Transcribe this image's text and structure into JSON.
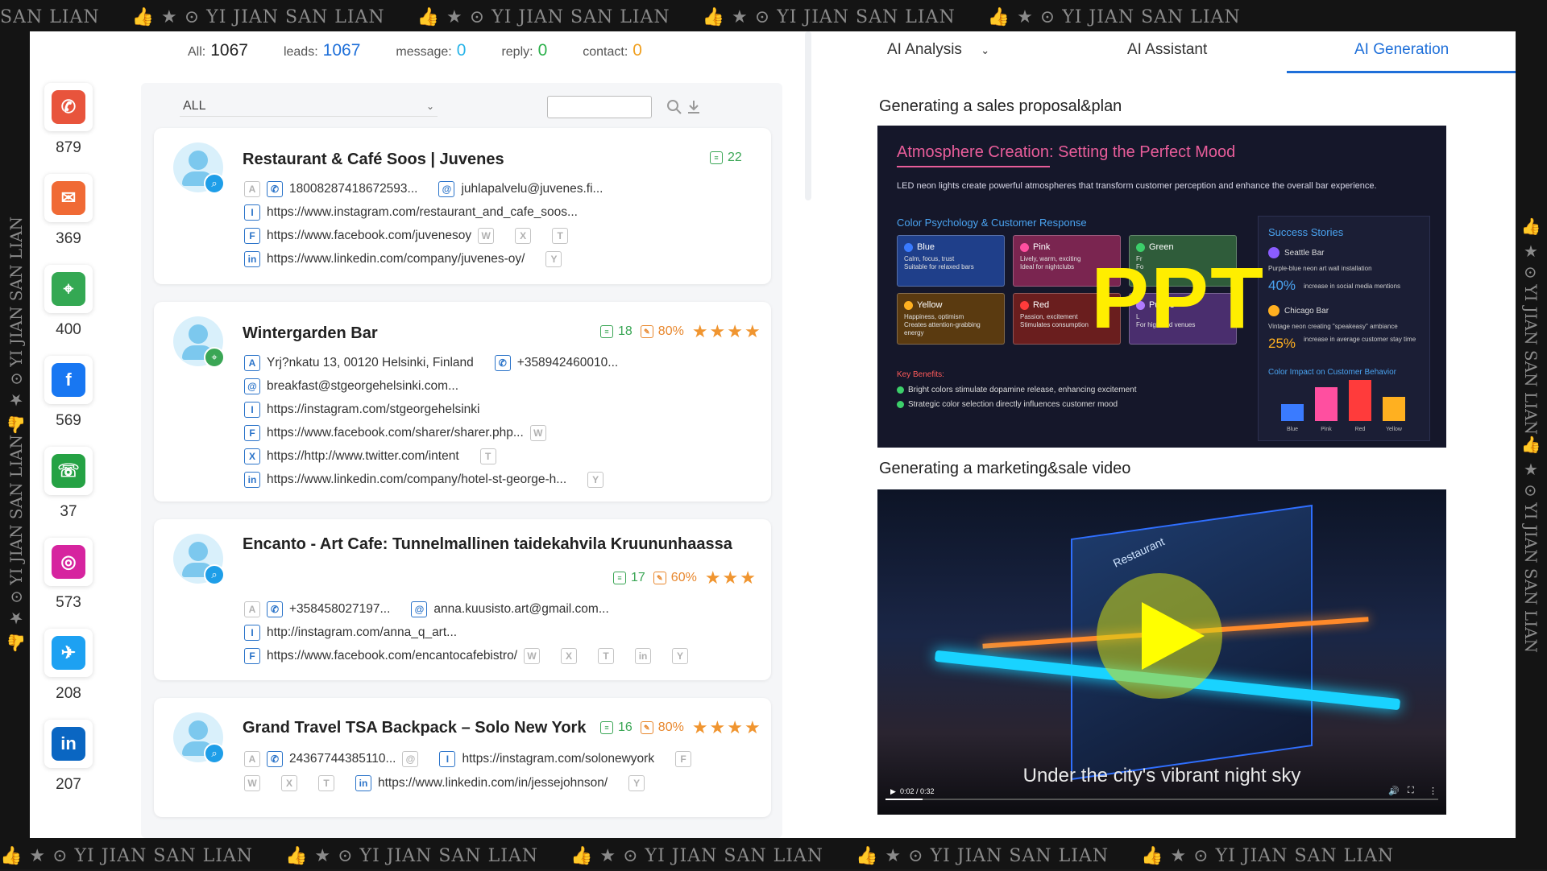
{
  "watermark": "👍 ★ ⊙ YI JIAN SAN LIAN",
  "watermark_head": "SAN LIAN",
  "social": [
    {
      "name": "phone",
      "count": "879",
      "color": "#e8543c",
      "glyph": "✆"
    },
    {
      "name": "email",
      "count": "369",
      "color": "#f06a35",
      "glyph": "✉"
    },
    {
      "name": "maps",
      "count": "400",
      "color": "#34a853",
      "glyph": "⌖"
    },
    {
      "name": "facebook",
      "count": "569",
      "color": "#1877f2",
      "glyph": "f"
    },
    {
      "name": "whatsapp",
      "count": "37",
      "color": "#25a244",
      "glyph": "☏"
    },
    {
      "name": "instagram",
      "count": "573",
      "color": "#d6249f",
      "glyph": "◎"
    },
    {
      "name": "twitter",
      "count": "208",
      "color": "#1da1f2",
      "glyph": "✈"
    },
    {
      "name": "linkedin",
      "count": "207",
      "color": "#0a66c2",
      "glyph": "in"
    }
  ],
  "stats": {
    "all_label": "All:",
    "all_value": "1067",
    "leads_label": "leads:",
    "leads_value": "1067",
    "message_label": "message:",
    "message_value": "0",
    "reply_label": "reply:",
    "reply_value": "0",
    "contact_label": "contact:",
    "contact_value": "0"
  },
  "filter": {
    "selected": "ALL"
  },
  "cards": [
    {
      "title": "Restaurant & Café Soos | Juvenes",
      "count": "22",
      "phone": "18008287418672593...",
      "email": "juhlapalvelu@juvenes.fi...",
      "instagram": "https://www.instagram.com/restaurant_and_cafe_soos...",
      "facebook": "https://www.facebook.com/juvenesoy",
      "linkedin": "https://www.linkedin.com/company/juvenes-oy/"
    },
    {
      "title": "Wintergarden Bar",
      "count": "18",
      "percent": "80%",
      "address": "Yrj?nkatu 13, 00120 Helsinki, Finland",
      "phone": "+358942460010...",
      "email": "breakfast@stgeorgehelsinki.com...",
      "instagram": "https://instagram.com/stgeorgehelsinki",
      "facebook": "https://www.facebook.com/sharer/sharer.php...",
      "twitter": "https://http://www.twitter.com/intent",
      "linkedin": "https://www.linkedin.com/company/hotel-st-george-h..."
    },
    {
      "title": "Encanto - Art Cafe: Tunnelmallinen taidekahvila Kruununhaassa",
      "count": "17",
      "percent": "60%",
      "phone": "+358458027197...",
      "email": "anna.kuusisto.art@gmail.com...",
      "instagram": "http://instagram.com/anna_q_art...",
      "facebook": "https://www.facebook.com/encantocafebistro/"
    },
    {
      "title": "Grand Travel TSA Backpack – Solo New York",
      "count": "16",
      "percent": "80%",
      "phone": "24367744385110...",
      "instagram": "https://instagram.com/solonewyork",
      "linkedin": "https://www.linkedin.com/in/jessejohnson/"
    }
  ],
  "tabs": {
    "analysis": "AI Analysis",
    "assistant": "AI Assistant",
    "generation": "AI Generation"
  },
  "section1": "Generating a sales proposal&plan",
  "section2": "Generating a marketing&sale video",
  "ppt": {
    "title": "Atmosphere Creation: Setting the Perfect Mood",
    "desc": "LED neon lights create powerful atmospheres that transform customer perception and enhance the overall bar experience.",
    "subtitle": "Color Psychology & Customer Response",
    "big": "PPT",
    "colors": [
      {
        "label": "Blue",
        "color": "#3a7bff",
        "d1": "Calm, focus, trust",
        "d2": "Suitable for relaxed bars",
        "bg": "#1f3f8a"
      },
      {
        "label": "Pink",
        "color": "#ff4fa0",
        "d1": "Lively, warm, exciting",
        "d2": "Ideal for nightclubs",
        "bg": "#7a2550"
      },
      {
        "label": "Green",
        "color": "#3ccf6a",
        "d1": "Fr",
        "d2": "Fo",
        "bg": "#2f5c3a"
      },
      {
        "label": "Yellow",
        "color": "#ffb020",
        "d1": "Happiness, optimism",
        "d2": "Creates attention-grabbing energy",
        "bg": "#5a3a10"
      },
      {
        "label": "Red",
        "color": "#ff3b3b",
        "d1": "Passion, excitement",
        "d2": "Stimulates consumption",
        "bg": "#6a1e1e"
      },
      {
        "label": "Purple",
        "color": "#b07aff",
        "d1": "L",
        "d2": "For high-end venues",
        "bg": "#4a2e6e"
      }
    ],
    "benefits_title": "Key Benefits:",
    "benefits": [
      "Bright colors stimulate dopamine release, enhancing excitement",
      "Strategic color selection directly influences customer mood"
    ],
    "success_title": "Success Stories",
    "story1_name": "Seattle Bar",
    "story1_text": "Purple-blue neon art wall installation",
    "story1_num": "40%",
    "story1_desc": "increase in social media mentions",
    "story2_name": "Chicago Bar",
    "story2_text": "Vintage neon creating \"speakeasy\" ambiance",
    "story2_num": "25%",
    "story2_desc": "increase in average customer stay time",
    "impact_title": "Color Impact on Customer Behavior",
    "bars": [
      {
        "label": "Blue",
        "value": 0.35,
        "color": "#3a7bff"
      },
      {
        "label": "Pink",
        "value": 0.7,
        "color": "#ff4fa0"
      },
      {
        "label": "Red",
        "value": 0.85,
        "color": "#ff3b3b"
      },
      {
        "label": "Yellow",
        "value": 0.5,
        "color": "#ffb020"
      }
    ]
  },
  "video": {
    "caption": "Under the city's vibrant night sky",
    "time": "0:02 / 0:32",
    "sign": "Restaurant"
  }
}
